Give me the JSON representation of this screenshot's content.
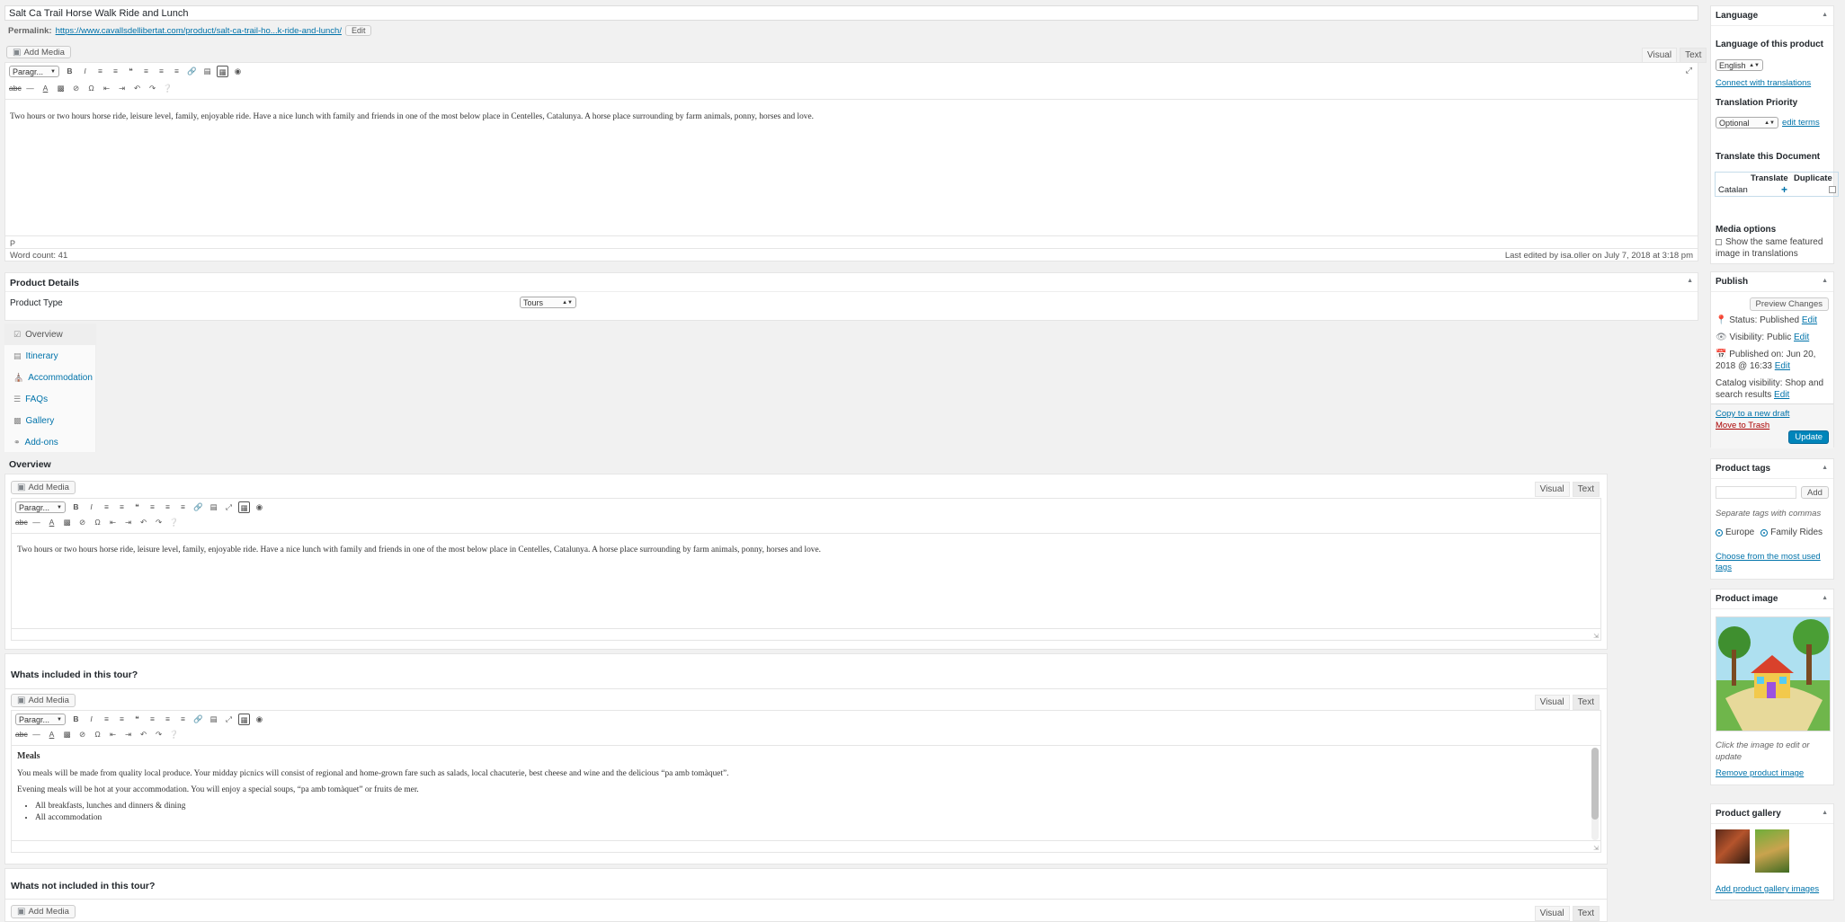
{
  "post": {
    "title": "Salt Ca Trail Horse Walk Ride and Lunch",
    "permalink_label": "Permalink:",
    "permalink_url": "https://www.cavallsdellibertat.com/product/salt-ca-trail-ho...k-ride-and-lunch/",
    "edit_label": "Edit"
  },
  "editor": {
    "add_media": "Add Media",
    "visual": "Visual",
    "text": "Text",
    "format": "Paragr...",
    "content": "Two hours or two hours horse ride, leisure level, family, enjoyable ride. Have a nice lunch with family and friends in one of the most below place in Centelles, Catalunya. A horse place surrounding by farm animals, ponny, horses and love.",
    "path": "P",
    "word_count": "Word count: 41",
    "last_edited": "Last edited by isa.oller on July 7, 2018 at 3:18 pm"
  },
  "product_details": {
    "title": "Product Details",
    "type_label": "Product Type",
    "type_value": "Tours",
    "tabs": [
      "Overview",
      "Itinerary",
      "Accommodation",
      "FAQs",
      "Gallery",
      "Add-ons"
    ]
  },
  "overview": {
    "heading": "Overview",
    "content": "Two hours or two hours horse ride, leisure level, family, enjoyable ride. Have a nice lunch with family and friends in one of the most below place in Centelles, Catalunya. A horse place surrounding by farm animals, ponny, horses and love."
  },
  "included": {
    "heading": "Whats included in this tour?",
    "meals_title": "Meals",
    "p1": "You meals will be made from quality local produce. Your midday picnics will consist of regional and home-grown fare such as salads, local chacuterie, best cheese and wine and the delicious “pa amb tomàquet”.",
    "p2": "Evening meals will be hot at your accommodation. You will enjoy a special  soups, “pa amb tomàquet” or fruits de mer.",
    "bullets": [
      "All breakfasts, lunches and dinners & dining",
      "All accommodation"
    ]
  },
  "not_included": {
    "heading": "Whats not included in this tour?"
  },
  "sidebar": {
    "language": {
      "title": "Language",
      "of_product": "Language of this product",
      "selected": "English",
      "connect": "Connect with translations",
      "priority_label": "Translation Priority",
      "priority_value": "Optional",
      "edit_terms": "edit terms",
      "translate_doc": "Translate this Document",
      "col_translate": "Translate",
      "col_duplicate": "Duplicate",
      "row_lang": "Catalan",
      "media_options": "Media options",
      "same_featured": "Show the same featured image in translations"
    },
    "publish": {
      "title": "Publish",
      "preview": "Preview Changes",
      "status": "Status: Published",
      "visibility": "Visibility: Public",
      "published_on": "Published on: Jun 20, 2018 @ 16:33",
      "catalog": "Catalog visibility: Shop and search results",
      "edit": "Edit",
      "copy_draft": "Copy to a new draft",
      "trash": "Move to Trash",
      "update": "Update"
    },
    "tags": {
      "title": "Product tags",
      "add": "Add",
      "hint": "Separate tags with commas",
      "tag1": "Europe",
      "tag2": "Family Rides",
      "choose": "Choose from the most used tags"
    },
    "image": {
      "title": "Product image",
      "hint": "Click the image to edit or update",
      "remove": "Remove product image"
    },
    "gallery": {
      "title": "Product gallery",
      "add": "Add product gallery images"
    }
  },
  "colors": {
    "link": "#0073aa",
    "update_button": "#0085ba",
    "trash": "#a00"
  }
}
